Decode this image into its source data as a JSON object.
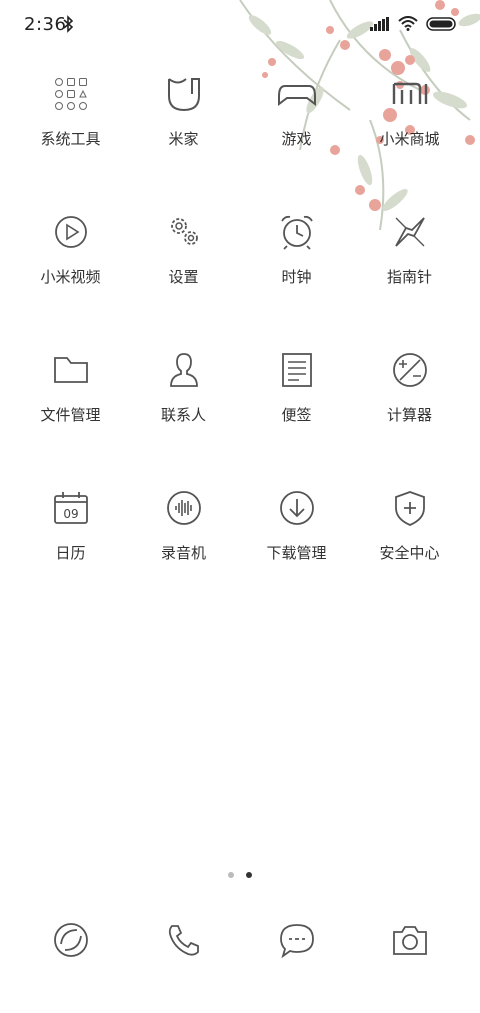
{
  "status_bar": {
    "time": "2:36",
    "icons": [
      "bluetooth-icon",
      "signal-icon",
      "wifi-icon",
      "battery-icon"
    ]
  },
  "apps": [
    {
      "label": "系统工具",
      "icon": "folder-grid-icon"
    },
    {
      "label": "米家",
      "icon": "mijia-icon"
    },
    {
      "label": "游戏",
      "icon": "gamepad-icon"
    },
    {
      "label": "小米商城",
      "icon": "mi-store-icon"
    },
    {
      "label": "小米视频",
      "icon": "play-icon"
    },
    {
      "label": "设置",
      "icon": "gear-icon"
    },
    {
      "label": "时钟",
      "icon": "alarm-clock-icon"
    },
    {
      "label": "指南针",
      "icon": "compass-icon"
    },
    {
      "label": "文件管理",
      "icon": "folder-icon"
    },
    {
      "label": "联系人",
      "icon": "contact-icon"
    },
    {
      "label": "便签",
      "icon": "notes-icon"
    },
    {
      "label": "计算器",
      "icon": "calculator-icon"
    },
    {
      "label": "日历",
      "icon": "calendar-icon",
      "badge": "09"
    },
    {
      "label": "录音机",
      "icon": "recorder-icon"
    },
    {
      "label": "下载管理",
      "icon": "download-icon"
    },
    {
      "label": "安全中心",
      "icon": "shield-icon"
    }
  ],
  "page_indicator": {
    "count": 2,
    "active": 2
  },
  "dock": [
    {
      "icon": "browser-icon"
    },
    {
      "icon": "phone-icon"
    },
    {
      "icon": "message-icon"
    },
    {
      "icon": "camera-icon"
    }
  ],
  "colors": {
    "icon_stroke": "#555555",
    "label": "#333333",
    "blossom": "#e8a39a",
    "leaf": "#c9d2c2"
  }
}
